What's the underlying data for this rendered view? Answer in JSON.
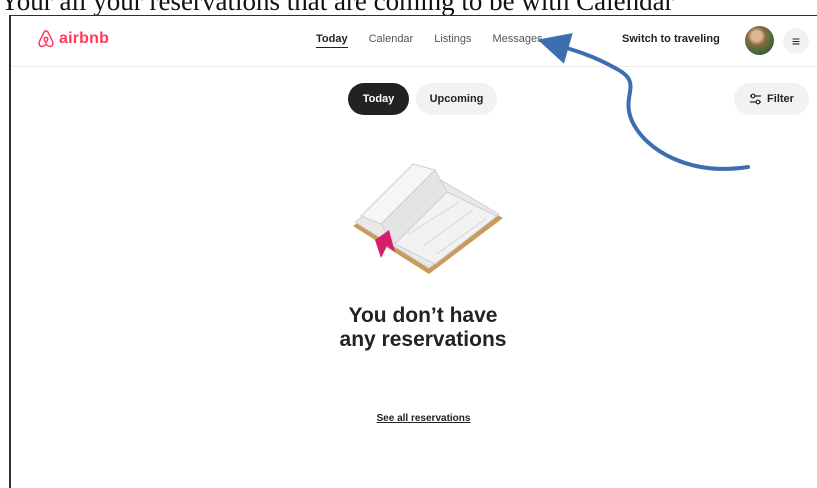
{
  "caption": {
    "text": "Your all your reservations that are coming to be with Calendar"
  },
  "header": {
    "logo_text": "airbnb",
    "nav": [
      {
        "label": "Today",
        "active": true
      },
      {
        "label": "Calendar",
        "active": false
      },
      {
        "label": "Listings",
        "active": false
      },
      {
        "label": "Messages",
        "active": false
      }
    ],
    "switch_label": "Switch to traveling",
    "menu_icon": "hamburger-icon"
  },
  "tabs": {
    "today": "Today",
    "upcoming": "Upcoming"
  },
  "filter": {
    "label": "Filter",
    "icon": "sliders-icon"
  },
  "empty_state": {
    "title_line1": "You don’t have",
    "title_line2": "any reservations",
    "link": "See all reservations",
    "illustration": "open-book-icon"
  },
  "colors": {
    "brand": "#ff385c",
    "arrow": "#3d6fb0",
    "active_pill": "#222222"
  }
}
